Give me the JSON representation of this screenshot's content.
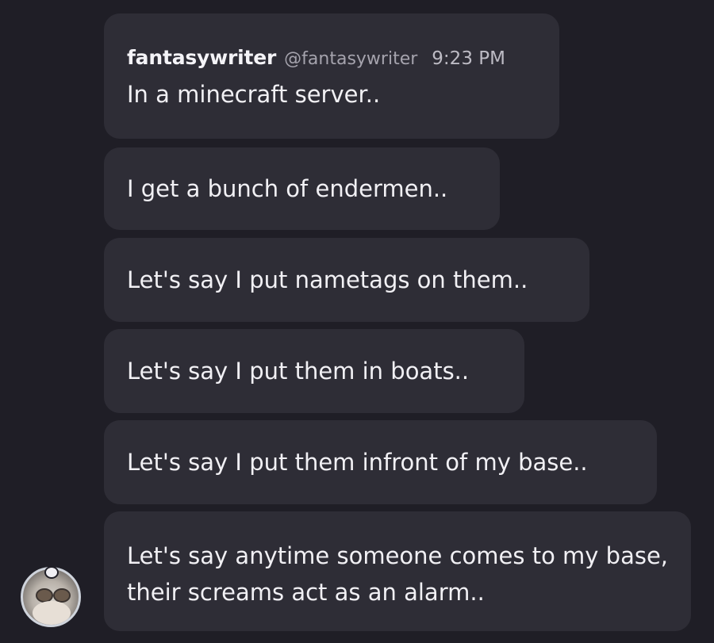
{
  "message": {
    "username": "fantasywriter",
    "handle": "@fantasywriter",
    "time": "9:23 PM"
  },
  "messages": [
    {
      "text": "In a minecraft server.."
    },
    {
      "text": "I get a bunch of endermen.."
    },
    {
      "text": "Let's say I put nametags on them.."
    },
    {
      "text": "Let's say I put them in boats.."
    },
    {
      "text": "Let's say I put them infront of my base.."
    },
    {
      "text": "Let's say anytime someone comes to my base, their screams act as an alarm.."
    }
  ],
  "colors": {
    "background": "#1f1e26",
    "bubble": "#2e2d36",
    "text": "#f1f0f4",
    "muted": "#a5a3ad"
  },
  "avatar": {
    "icon": "user-avatar-icon"
  }
}
